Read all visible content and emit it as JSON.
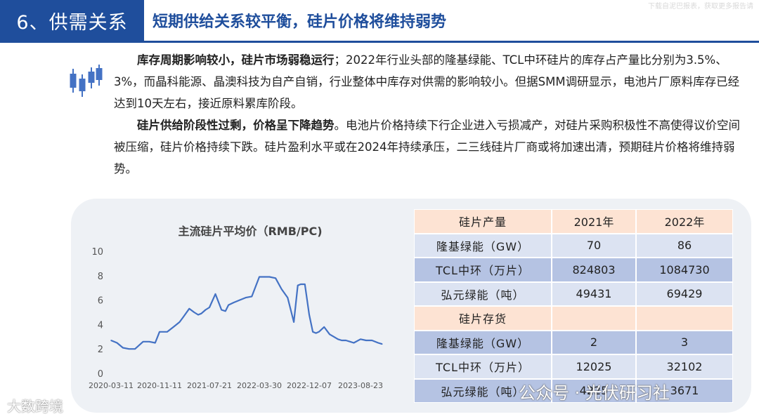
{
  "header": {
    "section": "6、供需关系",
    "title": "短期供给关系较平衡，硅片价格将维持弱势",
    "faint_text": "下载自泥巴报表，获取更多报告请"
  },
  "paragraphs": [
    {
      "bold": "库存周期影响较小，硅片市场弱稳运行",
      "text": "；2022年行业头部的隆基绿能、TCL中环硅片的库存占产量比分别为3.5%、3%，而晶科能源、晶澳科技为自产自销，行业整体中库存对供需的影响较小。但据SMM调研显示，电池片厂原料库存已经达到10天左右，接近原料累库阶段。"
    },
    {
      "bold": "硅片供给阶段性过剩，价格呈下降趋势",
      "text": "。电池片价格持续下行企业进入亏损减产，对硅片采购积极性不高使得议价空间被压缩，硅片价格持续下跌。硅片盈利水平或在2024年持续承压，二三线硅片厂商或将加速出清，预期硅片价格将维持弱势。"
    }
  ],
  "icon": "candlestick-chart-icon",
  "chart_data": {
    "type": "line",
    "title": "主流硅片平均价（RMB/PC)",
    "xlabel": "",
    "ylabel": "",
    "ylim": [
      0,
      10
    ],
    "yticks": [
      0,
      2,
      4,
      6,
      8,
      10
    ],
    "xticks": [
      "2020-03-11",
      "2020-11-11",
      "2021-07-21",
      "2022-03-30",
      "2022-12-07",
      "2023-08-23"
    ],
    "grid": false,
    "color": "#4472c4",
    "x": [
      "2020-03-11",
      "2020-04-10",
      "2020-05-10",
      "2020-06-10",
      "2020-07-10",
      "2020-08-20",
      "2020-09-20",
      "2020-10-20",
      "2020-11-11",
      "2020-12-20",
      "2021-01-20",
      "2021-02-20",
      "2021-03-10",
      "2021-04-10",
      "2021-05-05",
      "2021-05-25",
      "2021-06-10",
      "2021-07-01",
      "2021-07-21",
      "2021-08-20",
      "2021-09-20",
      "2021-10-10",
      "2021-10-25",
      "2021-11-20",
      "2021-12-20",
      "2022-01-20",
      "2022-02-20",
      "2022-03-30",
      "2022-04-25",
      "2022-05-20",
      "2022-06-20",
      "2022-07-20",
      "2022-08-20",
      "2022-09-20",
      "2022-10-10",
      "2022-10-25",
      "2022-11-15",
      "2022-12-07",
      "2022-12-25",
      "2023-01-10",
      "2023-01-25",
      "2023-02-20",
      "2023-03-20",
      "2023-04-10",
      "2023-05-01",
      "2023-05-20",
      "2023-06-10",
      "2023-07-01",
      "2023-07-20",
      "2023-08-23",
      "2023-09-20",
      "2023-10-20",
      "2023-11-20",
      "2023-12-10"
    ],
    "values": [
      2.7,
      2.5,
      2.1,
      2.0,
      2.0,
      2.6,
      2.6,
      2.5,
      3.4,
      3.4,
      3.8,
      4.2,
      4.6,
      5.3,
      5.0,
      4.8,
      4.9,
      5.2,
      5.4,
      6.5,
      5.2,
      5.1,
      5.6,
      5.8,
      6.0,
      6.2,
      6.3,
      7.9,
      7.9,
      7.9,
      7.8,
      6.9,
      6.2,
      4.2,
      7.2,
      7.3,
      7.3,
      4.8,
      3.4,
      3.3,
      3.4,
      3.8,
      3.2,
      3.0,
      2.8,
      2.7,
      2.7,
      2.6,
      2.5,
      2.8,
      2.7,
      2.7,
      2.5,
      2.4
    ]
  },
  "table": {
    "sections": [
      {
        "header": [
          "硅片产量",
          "2021年",
          "2022年"
        ],
        "rows": [
          [
            "隆基绿能（GW）",
            "70",
            "86"
          ],
          [
            "TCL中环（万片）",
            "824803",
            "1084730"
          ],
          [
            "弘元绿能（吨）",
            "49431",
            "69429"
          ]
        ]
      },
      {
        "header": [
          "硅片存货",
          "",
          ""
        ],
        "rows": [
          [
            "隆基绿能（GW）",
            "2",
            "3"
          ],
          [
            "TCL中环（万片）",
            "12025",
            "32102"
          ],
          [
            "弘元绿能（吨）",
            "4225",
            "3671"
          ]
        ]
      }
    ]
  },
  "watermarks": {
    "left": "大数跨境",
    "right": "公众号 · 光伏研习社"
  }
}
